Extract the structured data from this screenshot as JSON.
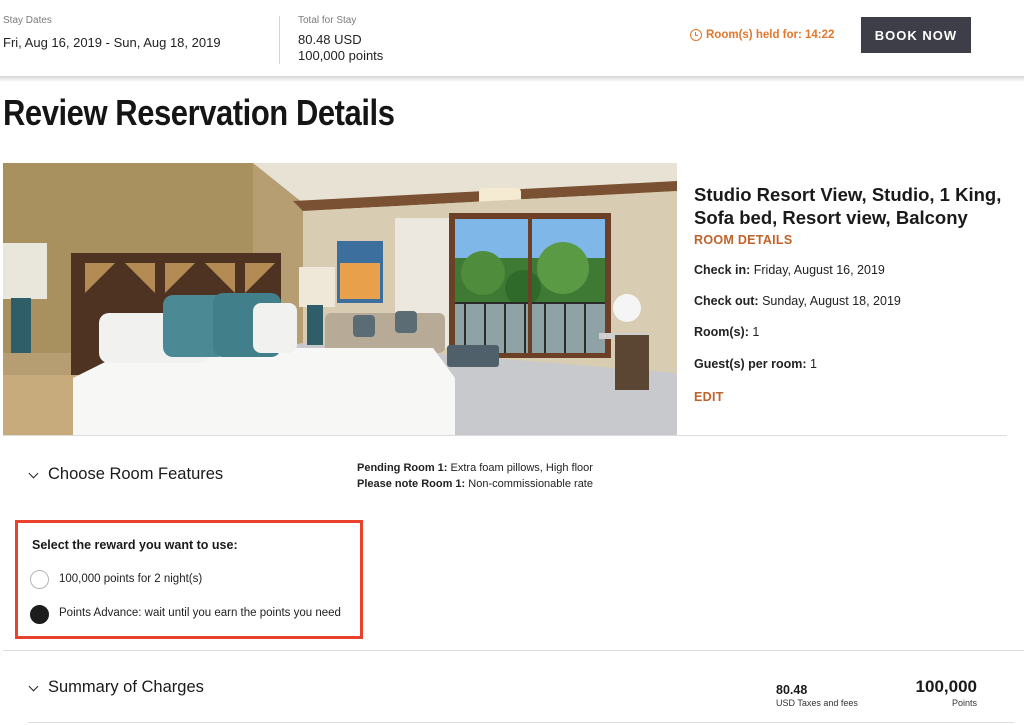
{
  "header": {
    "stay_dates_label": "Stay Dates",
    "stay_dates_value": "Fri, Aug 16, 2019 - Sun, Aug 18, 2019",
    "total_label": "Total for Stay",
    "total_usd": "80.48 USD",
    "total_points": "100,000 points",
    "hold_text": "Room(s) held for: 14:22",
    "book_button": "BOOK NOW"
  },
  "page": {
    "title": "Review Reservation Details"
  },
  "room": {
    "name": "Studio Resort View, Studio, 1 King, Sofa bed, Resort view, Balcony",
    "details_link": "ROOM DETAILS",
    "check_in_label": "Check in:",
    "check_in_value": "Friday, August 16, 2019",
    "check_out_label": "Check out:",
    "check_out_value": "Sunday, August 18, 2019",
    "rooms_label": "Room(s):",
    "rooms_value": "1",
    "guests_label": "Guest(s) per room:",
    "guests_value": "1",
    "edit_link": "EDIT"
  },
  "features": {
    "title": "Choose Room Features",
    "pending_label": "Pending Room 1:",
    "pending_value": "Extra foam pillows, High floor",
    "note_label": "Please note Room 1:",
    "note_value": "Non-commissionable rate"
  },
  "reward": {
    "title": "Select the reward you want to use:",
    "options": [
      {
        "label": "100,000 points for 2 night(s)",
        "selected": false
      },
      {
        "label": "Points Advance: wait until you earn the points you need",
        "selected": true
      }
    ]
  },
  "summary": {
    "title": "Summary of Charges",
    "usd_value": "80.48",
    "usd_label": "USD Taxes and fees",
    "points_value": "100,000",
    "points_label": "Points"
  },
  "colors": {
    "accent": "#c0622b",
    "hold": "#e2772d",
    "highlight_border": "#e8412c",
    "button": "#3e3e48"
  }
}
